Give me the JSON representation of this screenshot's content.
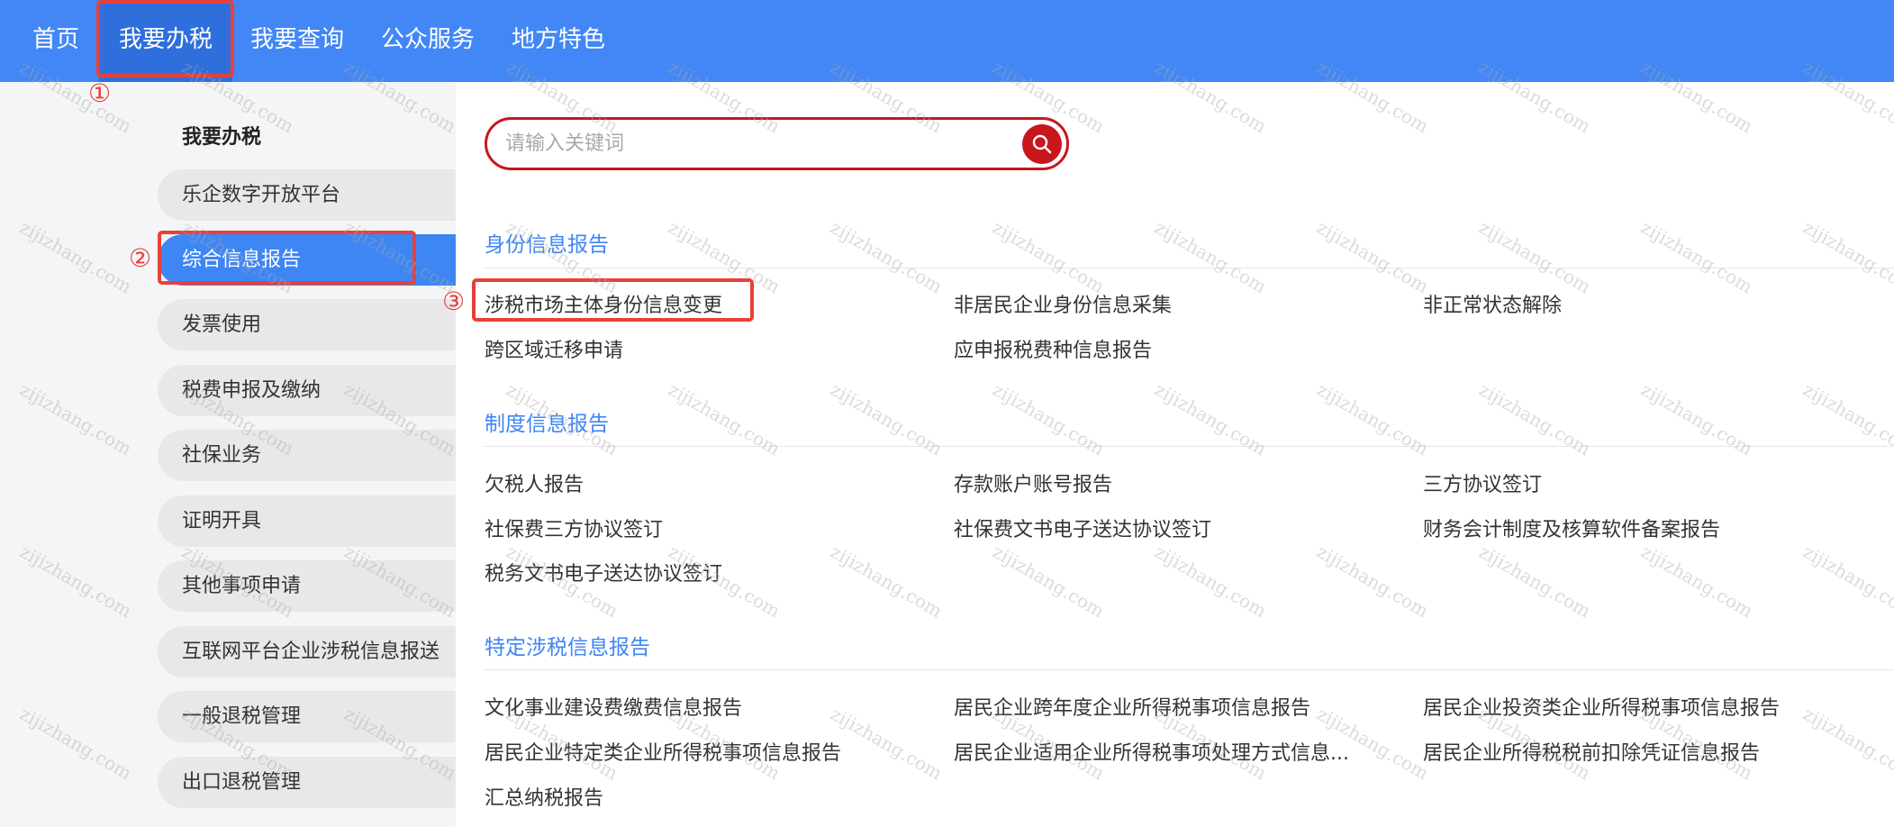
{
  "nav": {
    "items": [
      {
        "label": "首页"
      },
      {
        "label": "我要办税"
      },
      {
        "label": "我要查询"
      },
      {
        "label": "公众服务"
      },
      {
        "label": "地方特色"
      }
    ],
    "active_index": 1
  },
  "sidebar": {
    "title": "我要办税",
    "items": [
      {
        "label": "乐企数字开放平台"
      },
      {
        "label": "综合信息报告"
      },
      {
        "label": "发票使用"
      },
      {
        "label": "税费申报及缴纳"
      },
      {
        "label": "社保业务"
      },
      {
        "label": "证明开具"
      },
      {
        "label": "其他事项申请"
      },
      {
        "label": "互联网平台企业涉税信息报送"
      },
      {
        "label": "一般退税管理"
      },
      {
        "label": "出口退税管理"
      }
    ],
    "active_index": 1
  },
  "search": {
    "placeholder": "请输入关键词",
    "value": "",
    "icon": "search-icon"
  },
  "sections": [
    {
      "title": "身份信息报告",
      "links": [
        "涉税市场主体身份信息变更",
        "非居民企业身份信息采集",
        "非正常状态解除",
        "跨区域迁移申请",
        "应申报税费种信息报告"
      ]
    },
    {
      "title": "制度信息报告",
      "links": [
        "欠税人报告",
        "存款账户账号报告",
        "三方协议签订",
        "社保费三方协议签订",
        "社保费文书电子送达协议签订",
        "财务会计制度及核算软件备案报告",
        "税务文书电子送达协议签订"
      ]
    },
    {
      "title": "特定涉税信息报告",
      "links": [
        "文化事业建设费缴费信息报告",
        "居民企业跨年度企业所得税事项信息报告",
        "居民企业投资类企业所得税事项信息报告",
        "居民企业特定类企业所得税事项信息报告",
        "居民企业适用企业所得税事项处理方式信息...",
        "居民企业所得税税前扣除凭证信息报告",
        "汇总纳税报告"
      ]
    }
  ],
  "annotations": [
    "①",
    "②",
    "③"
  ],
  "watermark": "zijizhang.com",
  "colors": {
    "nav_bg": "#4287f5",
    "nav_active": "#2f6fdc",
    "sidebar_active": "#3d86f4",
    "section_title": "#3d86f4",
    "search_accent": "#c8161d",
    "annotation_red": "#e8403a"
  }
}
